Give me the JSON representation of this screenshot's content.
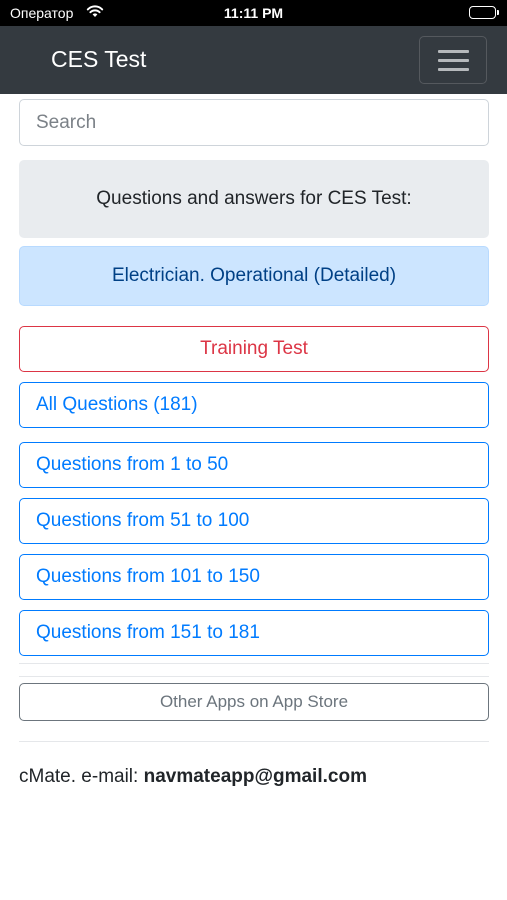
{
  "status_bar": {
    "carrier": "Оператор",
    "time": "11:11 PM"
  },
  "navbar": {
    "title": "CES Test"
  },
  "search": {
    "placeholder": "Search"
  },
  "intro": {
    "text": "Questions and answers for CES Test:"
  },
  "topic": {
    "text": "Electrician. Operational (Detailed)"
  },
  "buttons": {
    "training": "Training Test",
    "all_questions": "All Questions (181)",
    "ranges": [
      "Questions from 1 to 50",
      "Questions from 51 to 100",
      "Questions from 101 to 150",
      "Questions from 151 to 181"
    ],
    "other_apps": "Other Apps on App Store"
  },
  "footer": {
    "prefix": "cMate. e-mail: ",
    "email": "navmateapp@gmail.com"
  },
  "colors": {
    "navbar_bg": "#343a40",
    "primary": "#007bff",
    "danger": "#dc3545",
    "secondary": "#6c757d",
    "info_bg": "#cce5ff",
    "info_text": "#004085",
    "light_bg": "#e9ecef"
  }
}
